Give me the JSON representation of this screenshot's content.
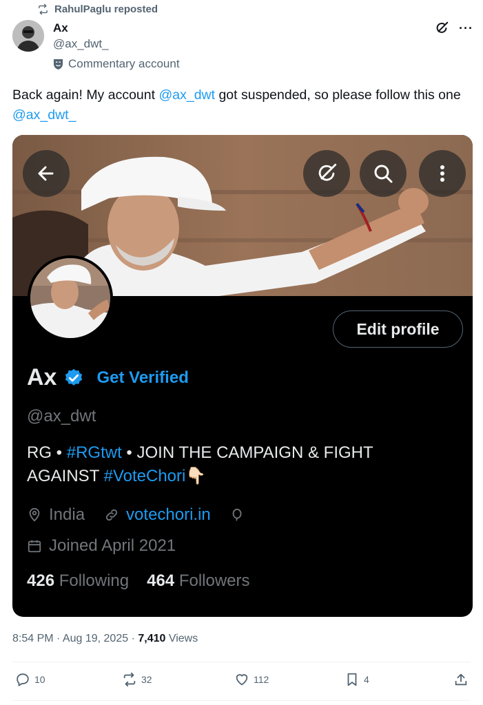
{
  "repost": {
    "label": "RahulPaglu reposted",
    "icon": "repost-icon"
  },
  "author": {
    "name": "Ax",
    "handle": "@ax_dwt_",
    "label": "Commentary account"
  },
  "tweet": {
    "text_1": "Back again! My account ",
    "mention_1": "@ax_dwt",
    "text_2": " got suspended, so please follow this one ",
    "mention_2": "@ax_dwt_"
  },
  "profile": {
    "name": "Ax",
    "get_verified": "Get Verified",
    "handle": "@ax_dwt",
    "edit_label": "Edit profile",
    "bio_1": "RG • ",
    "bio_tag_1": "#RGtwt",
    "bio_2": " • JOIN THE CAMPAIGN & FIGHT AGAINST ",
    "bio_tag_2": "#VoteChori",
    "bio_emoji": "👇🏻",
    "location": "India",
    "website": "votechori.in",
    "joined": "Joined April 2021",
    "following_count": "426",
    "following_label": "Following",
    "followers_count": "464",
    "followers_label": "Followers"
  },
  "meta": {
    "time": "8:54 PM · Aug 19, 2025 · ",
    "views_count": "7,410",
    "views_label": "Views"
  },
  "actions": {
    "replies": "10",
    "reposts": "32",
    "likes": "112",
    "bookmarks": "4"
  },
  "colors": {
    "accent": "#1d9bf0",
    "text": "#0f1419",
    "muted": "#536471",
    "card_bg": "#000000"
  }
}
